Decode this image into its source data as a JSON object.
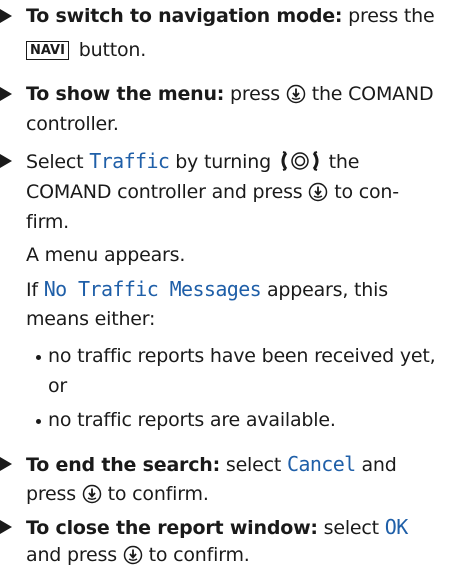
{
  "steps": [
    {
      "lead": "To switch to navigation mode:",
      "text_1": " press the",
      "key_label": "NAVI",
      "text_2": " button."
    },
    {
      "lead": "To show the menu:",
      "text_1": " press",
      "text_2": " the COMAND",
      "text_3": "controller."
    },
    {
      "text_1": "Select ",
      "option": "Traffic",
      "text_2": " by turning",
      "text_3": " the",
      "text_4": "COMAND controller and press",
      "text_5": " to con-",
      "text_6": "firm.",
      "result": "A menu appears.",
      "cond_1": "If ",
      "cond_option": "No Traffic Messages",
      "cond_2": " appears, this",
      "cond_3": "means either:",
      "bullet_1_a": "no traffic reports have been received yet,",
      "bullet_1_b": "or",
      "bullet_2": "no traffic reports are available."
    },
    {
      "lead": "To end the search:",
      "text_1": " select ",
      "option": "Cancel",
      "text_2": " and",
      "text_3": "press",
      "text_4": " to confirm."
    },
    {
      "lead": "To close the report window:",
      "text_1": " select ",
      "option": "OK",
      "text_2": "and press",
      "text_3": " to confirm."
    }
  ],
  "icons": {
    "press": "controller-press-icon",
    "turn": "controller-turn-icon"
  }
}
